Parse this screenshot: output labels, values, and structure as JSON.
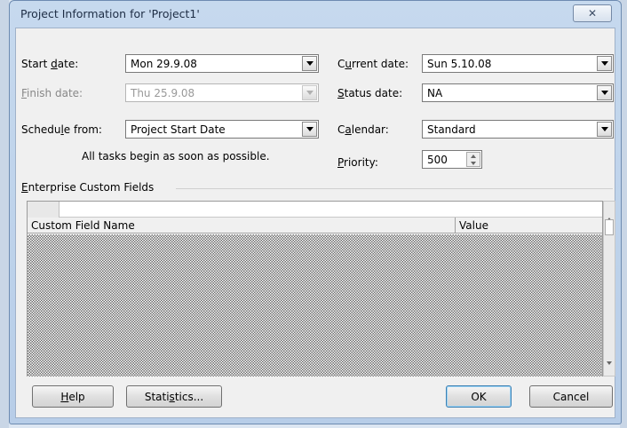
{
  "dialog": {
    "title": "Project Information for 'Project1'",
    "close_label": "✕"
  },
  "fields": {
    "start_date": {
      "label_pre": "Start ",
      "label_key": "d",
      "label_post": "ate:",
      "value": "Mon 29.9.08"
    },
    "finish_date": {
      "label_pre": "",
      "label_key": "F",
      "label_post": "inish date:",
      "value": "Thu 25.9.08"
    },
    "schedule_from": {
      "label_pre": "Schedu",
      "label_key": "l",
      "label_post": "e from:",
      "value": "Project Start Date"
    },
    "schedule_hint": "All tasks begin as soon as possible.",
    "current_date": {
      "label_pre": "C",
      "label_key": "u",
      "label_post": "rrent date:",
      "value": "Sun 5.10.08"
    },
    "status_date": {
      "label_pre": "",
      "label_key": "S",
      "label_post": "tatus date:",
      "value": "NA"
    },
    "calendar": {
      "label_pre": "C",
      "label_key": "a",
      "label_post": "lendar:",
      "value": "Standard"
    },
    "priority": {
      "label_pre": "",
      "label_key": "P",
      "label_post": "riority:",
      "value": "500"
    }
  },
  "enterprise": {
    "section_pre": "",
    "section_key": "E",
    "section_post": "nterprise Custom Fields",
    "col_name": "Custom Field Name",
    "col_value": "Value"
  },
  "buttons": {
    "help_key": "H",
    "help_post": "elp",
    "stats_pre": "Stati",
    "stats_key": "s",
    "stats_post": "tics...",
    "ok": "OK",
    "cancel": "Cancel"
  }
}
